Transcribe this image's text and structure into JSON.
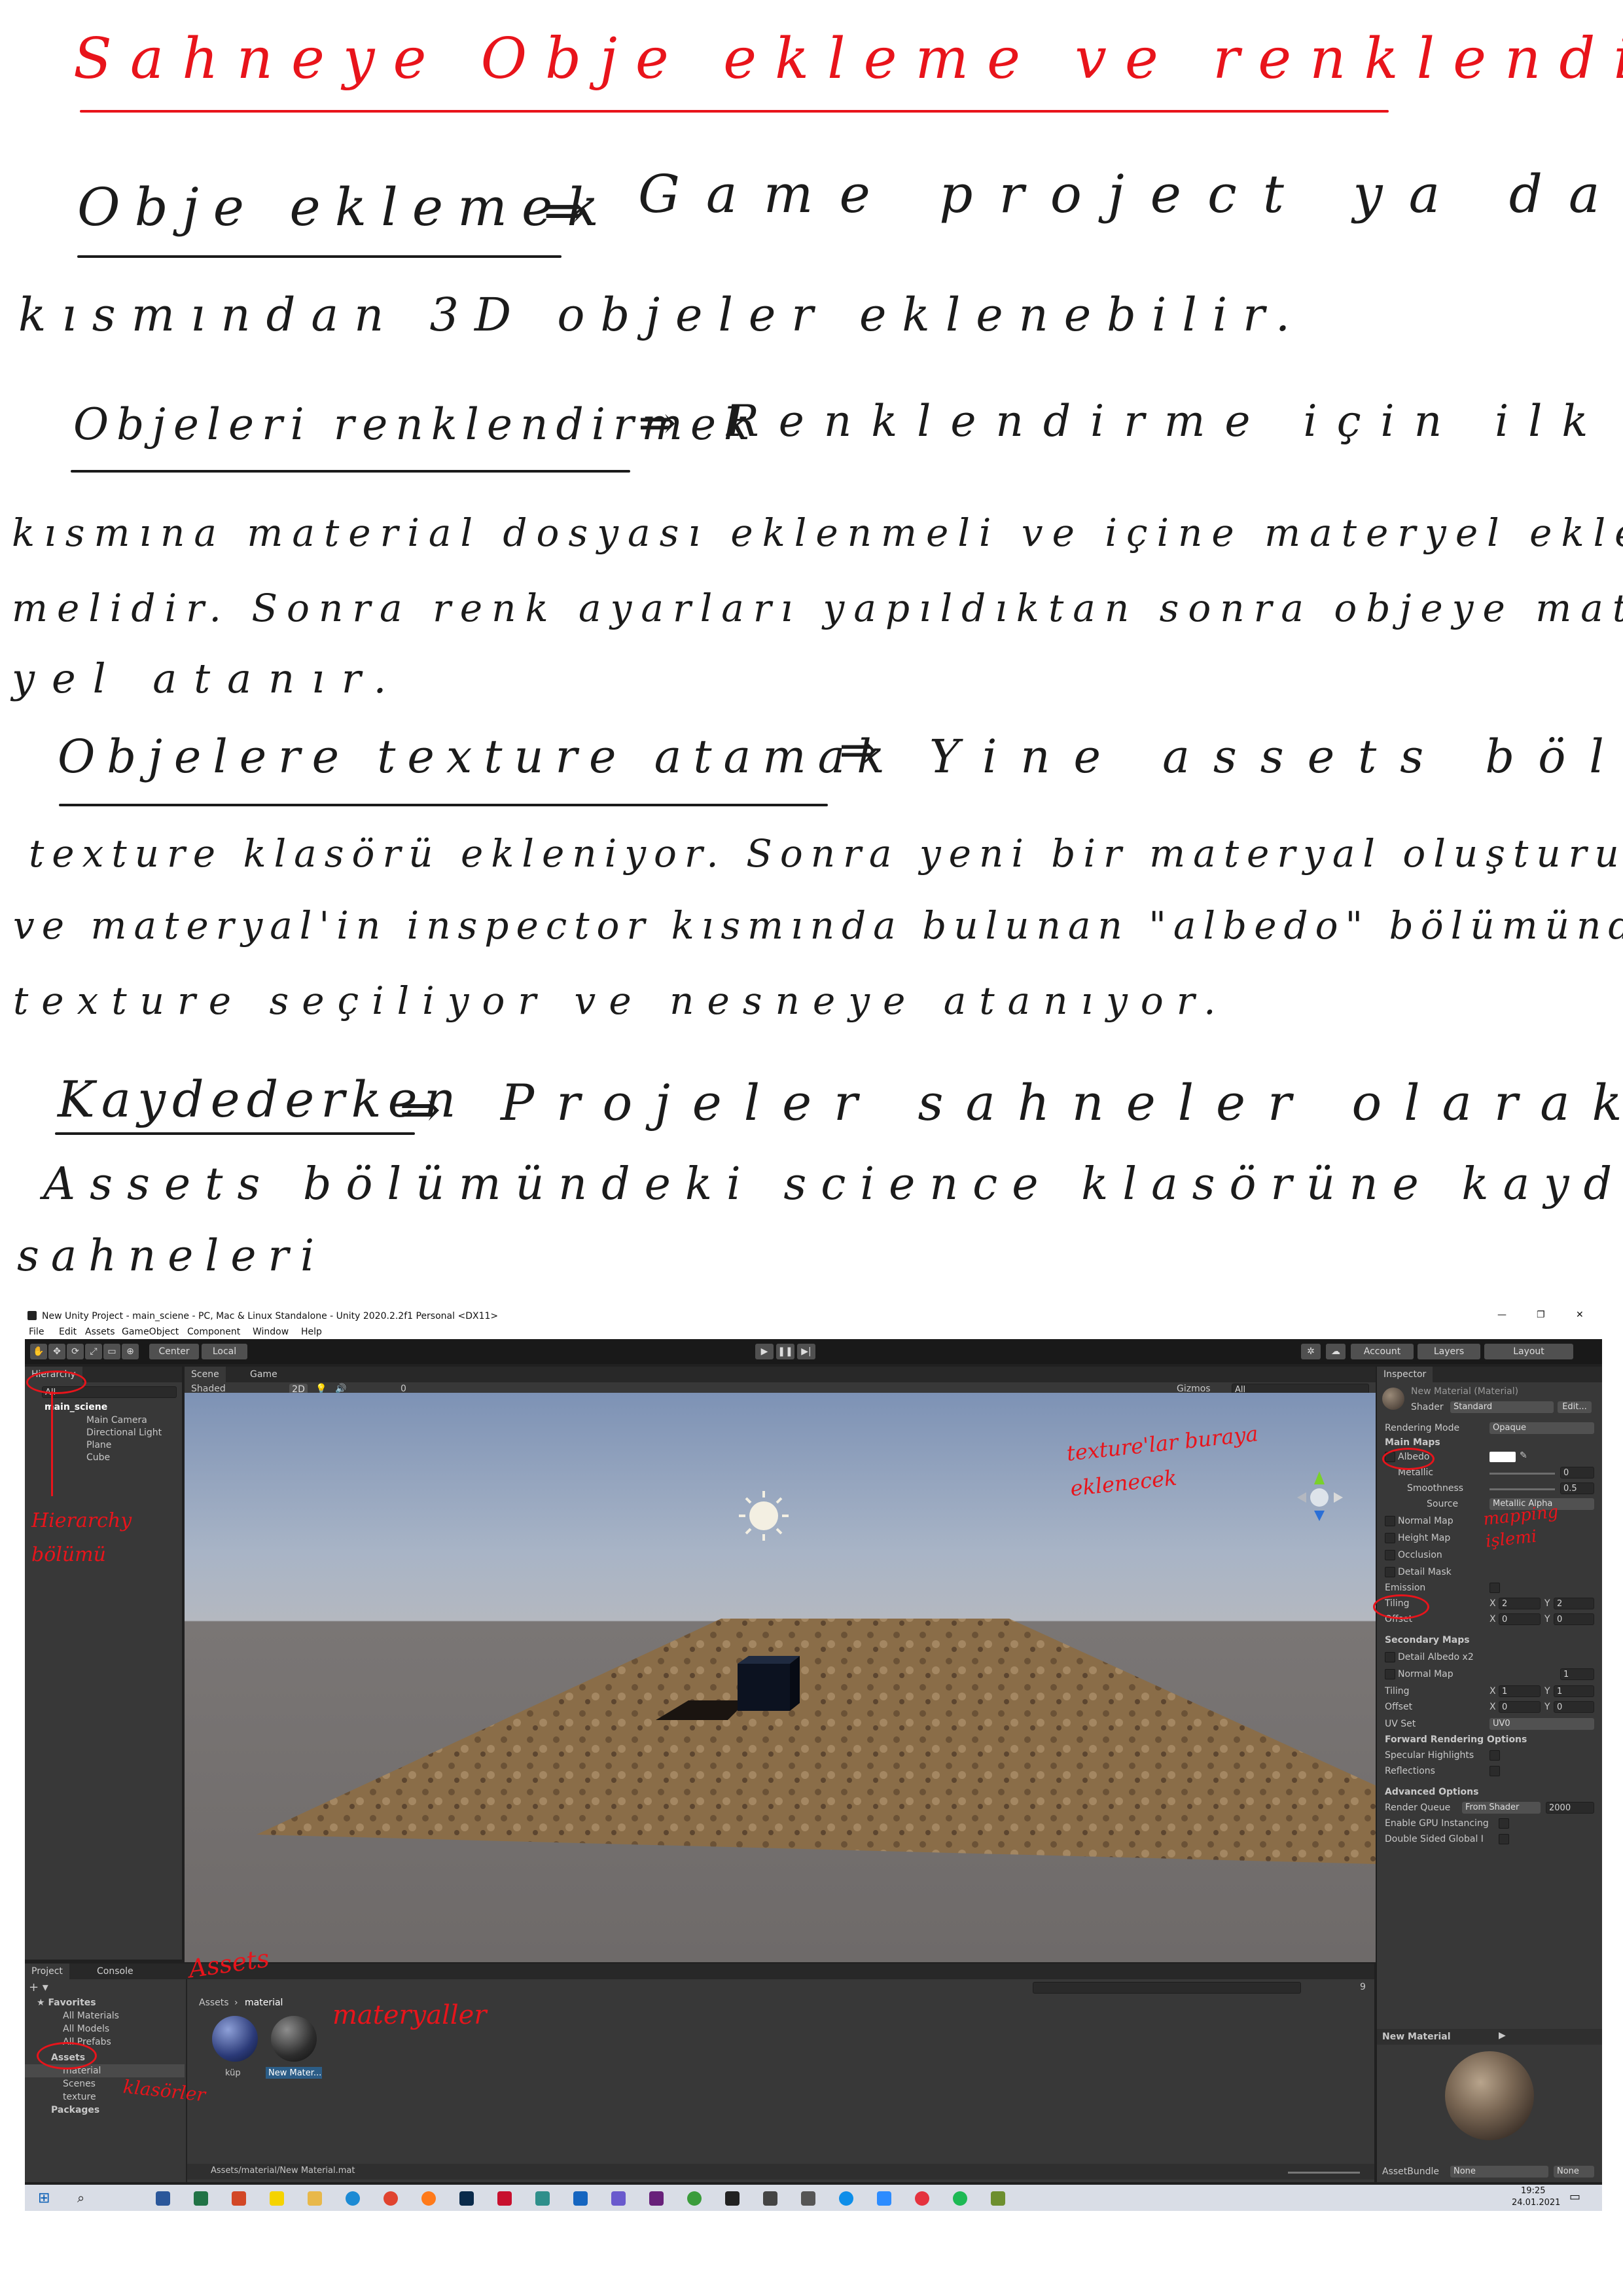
{
  "notes": {
    "title": "Sahneye Obje ekleme ve renklendirme",
    "sections": [
      {
        "heading": "Obje eklemek",
        "lines": [
          "Game project ya da hierarchy",
          "kısmından 3D objeler eklenebilir."
        ]
      },
      {
        "heading": "Objeleri renklendirmek",
        "lines": [
          "Renklendirme için ilk önce assets",
          "kısmına material dosyası eklenmeli ve içine materyel eklen-",
          "melidir. Sonra renk ayarları yapıldıktan sonra objeye mater-",
          "yel atanır."
        ]
      },
      {
        "heading": "Objelere texture atamak",
        "lines": [
          "Yine assets bölümüne",
          "texture klasörü ekleniyor. Sonra yeni bir materyal oluşturuluyor",
          "ve materyal'in inspector kısmında bulunan \"albedo\" bölümünden",
          "texture seçiliyor ve nesneye atanıyor."
        ]
      },
      {
        "heading": "Kaydederken",
        "lines": [
          "Projeler sahneler olarak kaydedilir.",
          "Assets bölümündeki science klasörüne kaydediyoruz",
          "sahneleri"
        ]
      }
    ]
  },
  "unity": {
    "window_title": "New Unity Project - main_sciene - PC, Mac & Linux Standalone - Unity 2020.2.2f1 Personal <DX11>",
    "menu": [
      "File",
      "Edit",
      "Assets",
      "GameObject",
      "Component",
      "Window",
      "Help"
    ],
    "toolbar": {
      "pivot": "Center",
      "space": "Local",
      "account": "Account",
      "layers": "Layers",
      "layout": "Layout"
    },
    "hierarchy": {
      "tab": "Hierarchy",
      "search": "All",
      "scene": "main_sciene",
      "items": [
        "Main Camera",
        "Directional Light",
        "Plane",
        "Cube"
      ]
    },
    "scene": {
      "tab_scene": "Scene",
      "tab_game": "Game",
      "shading": "Shaded",
      "mode2d": "2D",
      "gizmos": "Gizmos",
      "search": "All",
      "hidden_count": "0"
    },
    "inspector": {
      "tab": "Inspector",
      "material_name": "New Material (Material)",
      "shader_label": "Shader",
      "shader_value": "Standard",
      "edit_button": "Edit...",
      "rendering_mode_label": "Rendering Mode",
      "rendering_mode_value": "Opaque",
      "main_maps": "Main Maps",
      "albedo": "Albedo",
      "metallic": "Metallic",
      "metallic_value": "0",
      "smoothness": "Smoothness",
      "smoothness_value": "0.5",
      "source": "Source",
      "source_value": "Metallic Alpha",
      "normal_map": "Normal Map",
      "height_map": "Height Map",
      "occlusion": "Occlusion",
      "detail_mask": "Detail Mask",
      "emission": "Emission",
      "tiling": "Tiling",
      "offset": "Offset",
      "tiling_x": "2",
      "tiling_y": "2",
      "offset_x": "0",
      "offset_y": "0",
      "secondary_maps": "Secondary Maps",
      "detail_albedo": "Detail Albedo x2",
      "secondary_normal": "Normal Map",
      "secondary_normal_value": "1",
      "sec_tiling_x": "1",
      "sec_tiling_y": "1",
      "sec_offset_x": "0",
      "sec_offset_y": "0",
      "uv_set": "UV Set",
      "uv_set_value": "UV0",
      "forward_options": "Forward Rendering Options",
      "specular_highlights": "Specular Highlights",
      "reflections": "Reflections",
      "advanced_options": "Advanced Options",
      "render_queue": "Render Queue",
      "render_queue_mode": "From Shader",
      "render_queue_value": "2000",
      "gpu_instancing": "Enable GPU Instancing",
      "double_sided": "Double Sided Global I",
      "preview_name": "New Material",
      "asset_bundle": "AssetBundle",
      "asset_bundle_value": "None",
      "asset_bundle_variant": "None"
    },
    "project": {
      "tab_project": "Project",
      "tab_console": "Console",
      "favorites": "Favorites",
      "favorite_items": [
        "All Materials",
        "All Models",
        "All Prefabs"
      ],
      "assets": "Assets",
      "asset_folders": [
        "material",
        "Scenes",
        "texture"
      ],
      "packages": "Packages",
      "breadcrumb_root": "Assets",
      "breadcrumb_current": "material",
      "files": [
        "küp",
        "New Mater..."
      ],
      "status_path": "Assets/material/New Material.mat",
      "hidden_count": "9"
    },
    "taskbar": {
      "time": "19:25",
      "date": "24.01.2021"
    }
  },
  "annotations": {
    "hierarchy": "Hierarchy bölümü",
    "assets": "Assets",
    "folders": "klasörler",
    "materials": "materyaller",
    "textures": "texture'lar buraya eklenecek",
    "mapping": "mapping işlemi"
  },
  "colors": {
    "ink": "#1b1b1b",
    "red_pen": "#e8141b",
    "unity_dark": "#383838",
    "unity_select": "#2c5d87"
  }
}
